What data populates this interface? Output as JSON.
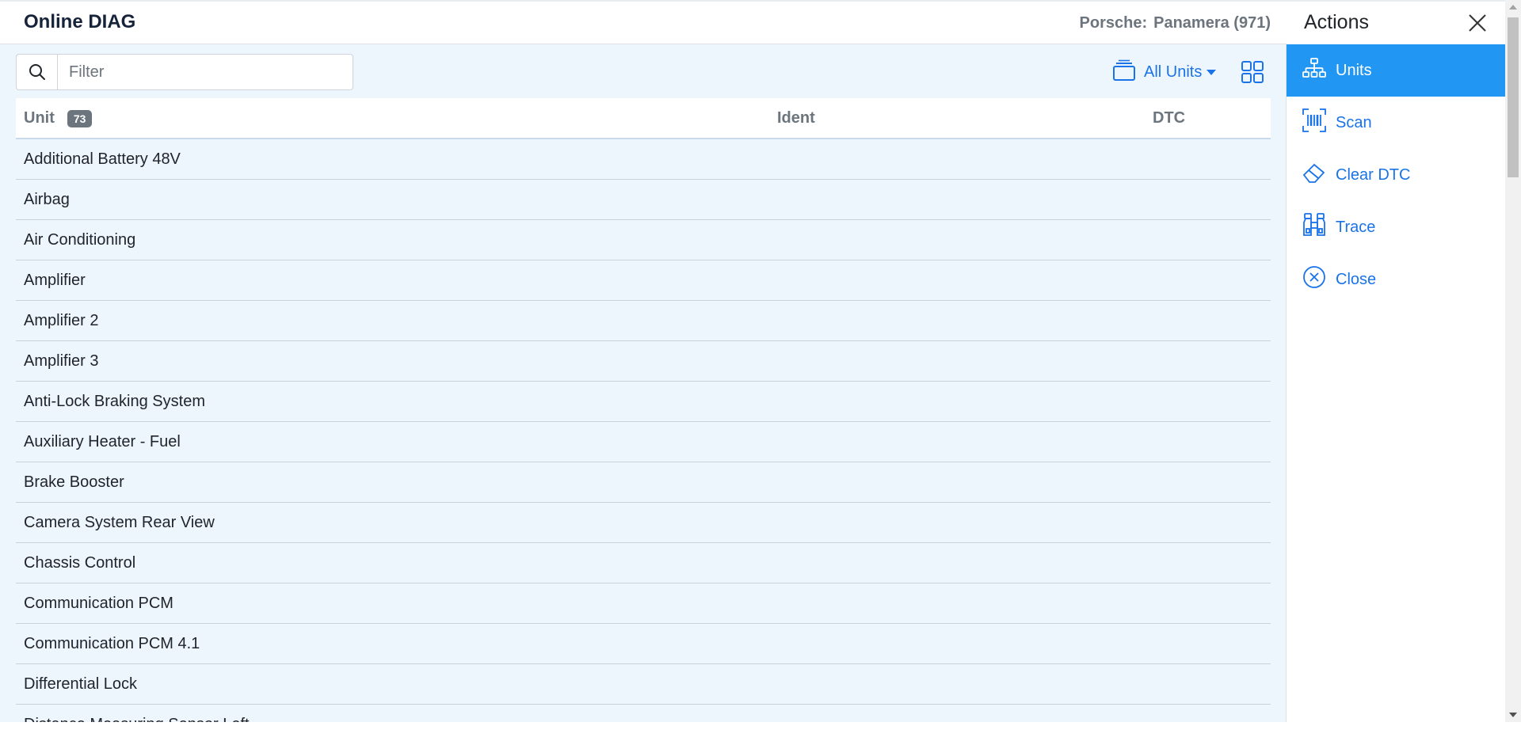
{
  "header": {
    "title": "Online DIAG",
    "vehicle_make": "Porsche:",
    "vehicle_model": "Panamera (971)"
  },
  "filter": {
    "placeholder": "Filter",
    "value": ""
  },
  "units_dropdown": {
    "label": "All Units"
  },
  "table": {
    "columns": {
      "unit": "Unit",
      "unit_count": "73",
      "ident": "Ident",
      "dtc": "DTC"
    },
    "rows": [
      "Additional Battery 48V",
      "Airbag",
      "Air Conditioning",
      "Amplifier",
      "Amplifier 2",
      "Amplifier 3",
      "Anti-Lock Braking System",
      "Auxiliary Heater - Fuel",
      "Brake Booster",
      "Camera System Rear View",
      "Chassis Control",
      "Communication PCM",
      "Communication PCM 4.1",
      "Differential Lock",
      "Distance Measuring Sensor Left"
    ]
  },
  "actions": {
    "title": "Actions",
    "items": [
      {
        "label": "Units",
        "icon": "sitemap-icon",
        "active": true
      },
      {
        "label": "Scan",
        "icon": "barcode-scan-icon",
        "active": false
      },
      {
        "label": "Clear DTC",
        "icon": "eraser-icon",
        "active": false
      },
      {
        "label": "Trace",
        "icon": "binoculars-icon",
        "active": false
      },
      {
        "label": "Close",
        "icon": "close-circle-icon",
        "active": false
      }
    ]
  },
  "colors": {
    "accent": "#1a73e8",
    "active_bg": "#2196f3",
    "main_bg": "#eef6fd",
    "title": "#17233a"
  }
}
